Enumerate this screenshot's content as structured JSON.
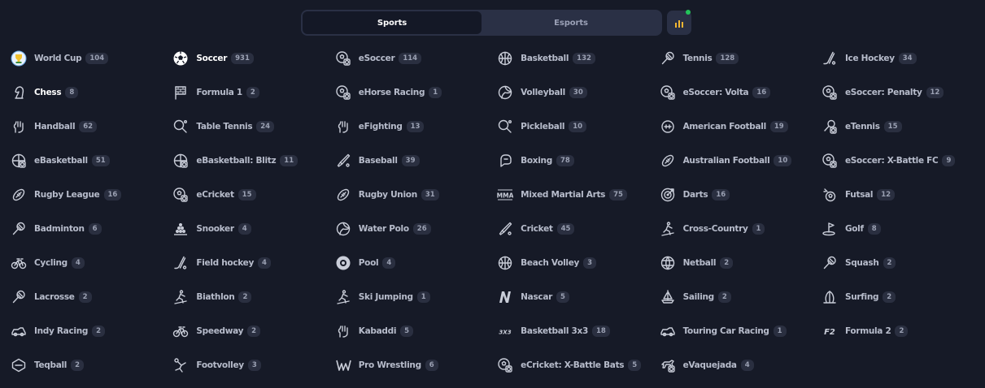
{
  "tabs": {
    "sports": "Sports",
    "esports": "Esports"
  },
  "colors": {
    "background": "#161a27",
    "notification_dot": "#23c45a",
    "chart_icon": "#f2b632"
  },
  "sports": [
    {
      "name": "World Cup",
      "count": "104",
      "icon": "world-cup-icon"
    },
    {
      "name": "Soccer",
      "count": "931",
      "icon": "soccer-ball-icon"
    },
    {
      "name": "eSoccer",
      "count": "114",
      "icon": "esoccer-icon"
    },
    {
      "name": "Basketball",
      "count": "132",
      "icon": "basketball-icon"
    },
    {
      "name": "Tennis",
      "count": "128",
      "icon": "tennis-icon"
    },
    {
      "name": "Ice Hockey",
      "count": "34",
      "icon": "ice-hockey-icon"
    },
    {
      "name": "Chess",
      "count": "8",
      "icon": "chess-knight-icon"
    },
    {
      "name": "Formula 1",
      "count": "2",
      "icon": "checkered-flag-icon"
    },
    {
      "name": "eHorse Racing",
      "count": "1",
      "icon": "ehorse-racing-icon"
    },
    {
      "name": "Volleyball",
      "count": "30",
      "icon": "volleyball-icon"
    },
    {
      "name": "eSoccer: Volta",
      "count": "16",
      "icon": "esoccer-volta-icon"
    },
    {
      "name": "eSoccer: Penalty",
      "count": "12",
      "icon": "esoccer-penalty-icon"
    },
    {
      "name": "Handball",
      "count": "62",
      "icon": "handball-icon"
    },
    {
      "name": "Table Tennis",
      "count": "24",
      "icon": "table-tennis-icon"
    },
    {
      "name": "eFighting",
      "count": "13",
      "icon": "efighting-icon"
    },
    {
      "name": "Pickleball",
      "count": "10",
      "icon": "pickleball-icon"
    },
    {
      "name": "American Football",
      "count": "19",
      "icon": "american-football-icon"
    },
    {
      "name": "eTennis",
      "count": "15",
      "icon": "etennis-icon"
    },
    {
      "name": "eBasketball",
      "count": "51",
      "icon": "ebasketball-icon"
    },
    {
      "name": "eBasketball: Blitz",
      "count": "11",
      "icon": "ebasketball-blitz-icon"
    },
    {
      "name": "Baseball",
      "count": "39",
      "icon": "baseball-icon"
    },
    {
      "name": "Boxing",
      "count": "78",
      "icon": "boxing-glove-icon"
    },
    {
      "name": "Australian Football",
      "count": "10",
      "icon": "australian-football-icon"
    },
    {
      "name": "eSoccer: X-Battle FC",
      "count": "9",
      "icon": "esoccer-xbattle-icon"
    },
    {
      "name": "Rugby League",
      "count": "16",
      "icon": "rugby-ball-icon"
    },
    {
      "name": "eCricket",
      "count": "15",
      "icon": "ecricket-icon"
    },
    {
      "name": "Rugby Union",
      "count": "31",
      "icon": "rugby-ball-icon"
    },
    {
      "name": "Mixed Martial Arts",
      "count": "75",
      "icon": "mma-icon"
    },
    {
      "name": "Darts",
      "count": "16",
      "icon": "darts-icon"
    },
    {
      "name": "Futsal",
      "count": "12",
      "icon": "futsal-icon"
    },
    {
      "name": "Badminton",
      "count": "6",
      "icon": "badminton-icon"
    },
    {
      "name": "Snooker",
      "count": "4",
      "icon": "snooker-icon"
    },
    {
      "name": "Water Polo",
      "count": "26",
      "icon": "water-polo-icon"
    },
    {
      "name": "Cricket",
      "count": "45",
      "icon": "cricket-bat-icon"
    },
    {
      "name": "Cross-Country",
      "count": "1",
      "icon": "cross-country-icon"
    },
    {
      "name": "Golf",
      "count": "8",
      "icon": "golf-icon"
    },
    {
      "name": "Cycling",
      "count": "4",
      "icon": "bicycle-icon"
    },
    {
      "name": "Field hockey",
      "count": "4",
      "icon": "field-hockey-icon"
    },
    {
      "name": "Pool",
      "count": "4",
      "icon": "pool-ball-icon"
    },
    {
      "name": "Beach Volley",
      "count": "3",
      "icon": "beach-volley-icon"
    },
    {
      "name": "Netball",
      "count": "2",
      "icon": "netball-icon"
    },
    {
      "name": "Squash",
      "count": "2",
      "icon": "squash-icon"
    },
    {
      "name": "Lacrosse",
      "count": "2",
      "icon": "lacrosse-icon"
    },
    {
      "name": "Biathlon",
      "count": "2",
      "icon": "biathlon-icon"
    },
    {
      "name": "Ski Jumping",
      "count": "1",
      "icon": "ski-jumping-icon"
    },
    {
      "name": "Nascar",
      "count": "5",
      "icon": "nascar-icon"
    },
    {
      "name": "Sailing",
      "count": "2",
      "icon": "sailing-icon"
    },
    {
      "name": "Surfing",
      "count": "2",
      "icon": "surfing-icon"
    },
    {
      "name": "Indy Racing",
      "count": "2",
      "icon": "indy-racing-icon"
    },
    {
      "name": "Speedway",
      "count": "2",
      "icon": "speedway-icon"
    },
    {
      "name": "Kabaddi",
      "count": "5",
      "icon": "kabaddi-icon"
    },
    {
      "name": "Basketball 3x3",
      "count": "18",
      "icon": "basketball-3x3-icon"
    },
    {
      "name": "Touring Car Racing",
      "count": "1",
      "icon": "touring-car-icon"
    },
    {
      "name": "Formula 2",
      "count": "2",
      "icon": "formula-2-icon"
    },
    {
      "name": "Teqball",
      "count": "2",
      "icon": "teqball-icon"
    },
    {
      "name": "Footvolley",
      "count": "3",
      "icon": "footvolley-icon"
    },
    {
      "name": "Pro Wrestling",
      "count": "6",
      "icon": "pro-wrestling-icon"
    },
    {
      "name": "eCricket: X-Battle Bats",
      "count": "5",
      "icon": "ecricket-xbattle-icon"
    },
    {
      "name": "eVaquejada",
      "count": "4",
      "icon": "evaquejada-icon"
    }
  ]
}
